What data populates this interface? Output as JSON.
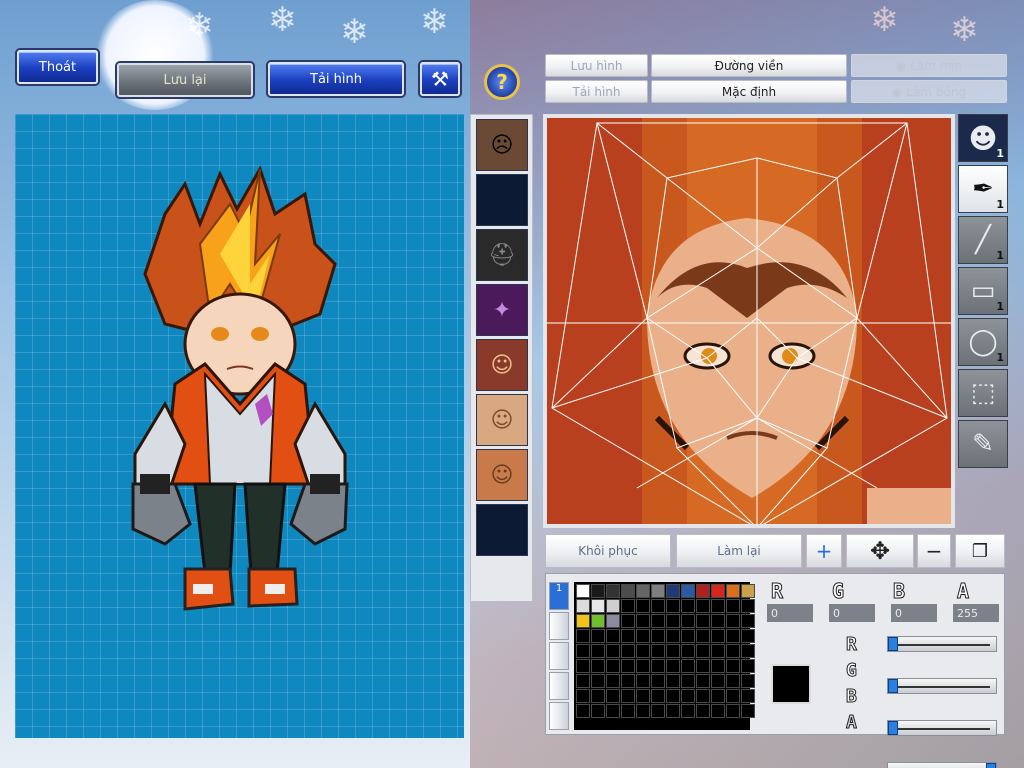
{
  "toolbar": {
    "exit_label": "Thoát",
    "save_label": "Lưu lại",
    "reload_label": "Tải hình",
    "help_label": "?"
  },
  "mode": {
    "save_image_label": "Lưu hình",
    "load_image_label": "Tải hình",
    "outline_label": "Đường viền",
    "default_label": "Mặc định",
    "smooth_label": "Làm mịn",
    "shade_label": "Làm bóng"
  },
  "parts": [
    {
      "icon": "☹"
    },
    {
      "icon": ""
    },
    {
      "icon": "⛑"
    },
    {
      "icon": "✦"
    },
    {
      "icon": "☺"
    },
    {
      "icon": "☺"
    },
    {
      "icon": "☺"
    },
    {
      "icon": ""
    }
  ],
  "tools": {
    "avatar_count": "1",
    "pen_count": "1",
    "line_count": "1",
    "rect_count": "1",
    "ellipse_count": "1"
  },
  "edit": {
    "restore_label": "Khôi phục",
    "redo_label": "Làm lại"
  },
  "palette": {
    "tabs": [
      "1",
      "",
      "",
      "",
      "",
      ""
    ],
    "colors": [
      "#ffffff",
      "#1a1a1a",
      "#333333",
      "#4d4d4d",
      "#666666",
      "#7f7f7f",
      "#203a78",
      "#2b5aa6",
      "#b0201e",
      "#d8261c",
      "#d96f1a",
      "#c9a24a",
      "#dcdcdc",
      "#e6e6e6",
      "#cfcfcf",
      "#000000",
      "#000000",
      "#000000",
      "#000000",
      "#000000",
      "#000000",
      "#000000",
      "#000000",
      "#000000",
      "#f2c21a",
      "#6fbf2a",
      "#8a8aa0",
      "#000000",
      "#000000",
      "#000000",
      "#000000",
      "#000000",
      "#000000",
      "#000000",
      "#000000",
      "#000000"
    ]
  },
  "channels": {
    "r_label": "R",
    "g_label": "G",
    "b_label": "B",
    "a_label": "A",
    "r_value": "0",
    "g_value": "0",
    "b_value": "0",
    "a_value": "255",
    "r_level": 0,
    "g_level": 0,
    "b_level": 0,
    "a_level": 1
  },
  "current_color": "#000000"
}
